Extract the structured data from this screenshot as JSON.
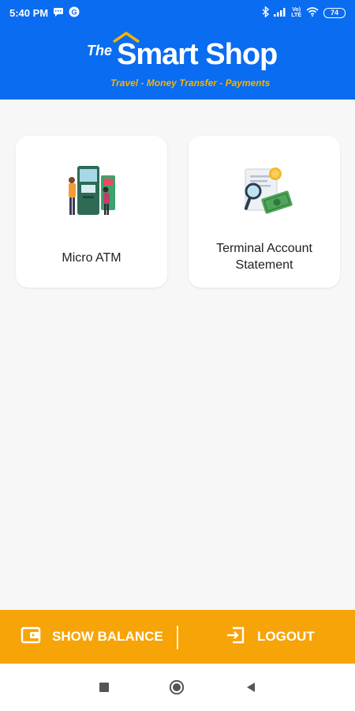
{
  "status_bar": {
    "time": "5:40 PM",
    "network": "Vo)\nLTE",
    "battery": "74"
  },
  "header": {
    "logo_the": "The",
    "logo_main": "Smart Shop",
    "tagline": "Travel - Money Transfer - Payments"
  },
  "tiles": [
    {
      "label": "Micro ATM",
      "icon": "atm-icon"
    },
    {
      "label": "Terminal Account\nStatement",
      "icon": "statement-icon"
    }
  ],
  "actions": {
    "show_balance": "SHOW BALANCE",
    "logout": "LOGOUT"
  },
  "colors": {
    "brand_blue": "#0a6cf0",
    "accent_orange": "#f7a408",
    "tagline_yellow": "#f6b300"
  }
}
